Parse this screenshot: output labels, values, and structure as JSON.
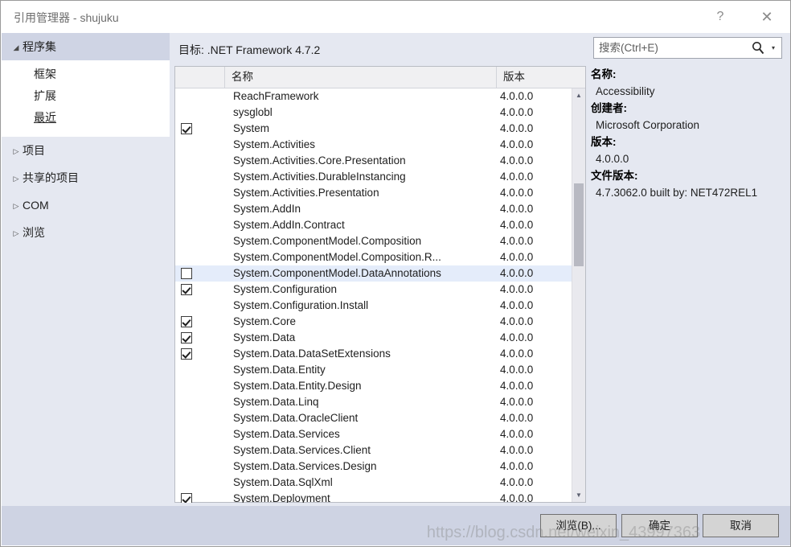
{
  "window": {
    "title": "引用管理器 - shujuku",
    "help_label": "?",
    "close_label": "✕"
  },
  "sidebar": {
    "categories": [
      {
        "label": "程序集",
        "expanded": true,
        "selected": true,
        "marker": "◢",
        "children": [
          {
            "label": "框架",
            "active": false
          },
          {
            "label": "扩展",
            "active": false
          },
          {
            "label": "最近",
            "active": true
          }
        ]
      },
      {
        "label": "项目",
        "expanded": false,
        "selected": false,
        "marker": "▷"
      },
      {
        "label": "共享的项目",
        "expanded": false,
        "selected": false,
        "marker": "▷"
      },
      {
        "label": "COM",
        "expanded": false,
        "selected": false,
        "marker": "▷"
      },
      {
        "label": "浏览",
        "expanded": false,
        "selected": false,
        "marker": "▷"
      }
    ]
  },
  "content": {
    "target_label": "目标: .NET Framework 4.7.2",
    "search": {
      "placeholder": "搜索(Ctrl+E)",
      "value": "",
      "icon": "search-icon",
      "dropdown_icon": "▾"
    },
    "list": {
      "headers": {
        "check": "",
        "name": "名称",
        "version": "版本"
      },
      "rows": [
        {
          "checked": false,
          "name": "ReachFramework",
          "version": "4.0.0.0",
          "selected": false
        },
        {
          "checked": false,
          "name": "sysglobl",
          "version": "4.0.0.0",
          "selected": false
        },
        {
          "checked": true,
          "name": "System",
          "version": "4.0.0.0",
          "selected": false
        },
        {
          "checked": false,
          "name": "System.Activities",
          "version": "4.0.0.0",
          "selected": false
        },
        {
          "checked": false,
          "name": "System.Activities.Core.Presentation",
          "version": "4.0.0.0",
          "selected": false
        },
        {
          "checked": false,
          "name": "System.Activities.DurableInstancing",
          "version": "4.0.0.0",
          "selected": false
        },
        {
          "checked": false,
          "name": "System.Activities.Presentation",
          "version": "4.0.0.0",
          "selected": false
        },
        {
          "checked": false,
          "name": "System.AddIn",
          "version": "4.0.0.0",
          "selected": false
        },
        {
          "checked": false,
          "name": "System.AddIn.Contract",
          "version": "4.0.0.0",
          "selected": false
        },
        {
          "checked": false,
          "name": "System.ComponentModel.Composition",
          "version": "4.0.0.0",
          "selected": false
        },
        {
          "checked": false,
          "name": "System.ComponentModel.Composition.R...",
          "version": "4.0.0.0",
          "selected": false
        },
        {
          "checked": false,
          "name": "System.ComponentModel.DataAnnotations",
          "version": "4.0.0.0",
          "selected": true,
          "checkbox_visible": true
        },
        {
          "checked": true,
          "name": "System.Configuration",
          "version": "4.0.0.0",
          "selected": false
        },
        {
          "checked": false,
          "name": "System.Configuration.Install",
          "version": "4.0.0.0",
          "selected": false
        },
        {
          "checked": true,
          "name": "System.Core",
          "version": "4.0.0.0",
          "selected": false
        },
        {
          "checked": true,
          "name": "System.Data",
          "version": "4.0.0.0",
          "selected": false
        },
        {
          "checked": true,
          "name": "System.Data.DataSetExtensions",
          "version": "4.0.0.0",
          "selected": false
        },
        {
          "checked": false,
          "name": "System.Data.Entity",
          "version": "4.0.0.0",
          "selected": false
        },
        {
          "checked": false,
          "name": "System.Data.Entity.Design",
          "version": "4.0.0.0",
          "selected": false
        },
        {
          "checked": false,
          "name": "System.Data.Linq",
          "version": "4.0.0.0",
          "selected": false
        },
        {
          "checked": false,
          "name": "System.Data.OracleClient",
          "version": "4.0.0.0",
          "selected": false
        },
        {
          "checked": false,
          "name": "System.Data.Services",
          "version": "4.0.0.0",
          "selected": false
        },
        {
          "checked": false,
          "name": "System.Data.Services.Client",
          "version": "4.0.0.0",
          "selected": false
        },
        {
          "checked": false,
          "name": "System.Data.Services.Design",
          "version": "4.0.0.0",
          "selected": false
        },
        {
          "checked": false,
          "name": "System.Data.SqlXml",
          "version": "4.0.0.0",
          "selected": false
        },
        {
          "checked": true,
          "name": "System.Deployment",
          "version": "4.0.0.0",
          "selected": false
        }
      ],
      "scrollbar": {
        "up_icon": "▲",
        "down_icon": "▼"
      }
    },
    "details": {
      "name_label": "名称:",
      "name_value": "Accessibility",
      "creator_label": "创建者:",
      "creator_value": "Microsoft Corporation",
      "version_label": "版本:",
      "version_value": "4.0.0.0",
      "file_version_label": "文件版本:",
      "file_version_value": "4.7.3062.0 built by: NET472REL1"
    }
  },
  "footer": {
    "browse_label": "浏览(B)...",
    "ok_label": "确定",
    "cancel_label": "取消"
  },
  "watermark": {
    "text": "https://blog.csdn.net/weixin_43997363"
  }
}
